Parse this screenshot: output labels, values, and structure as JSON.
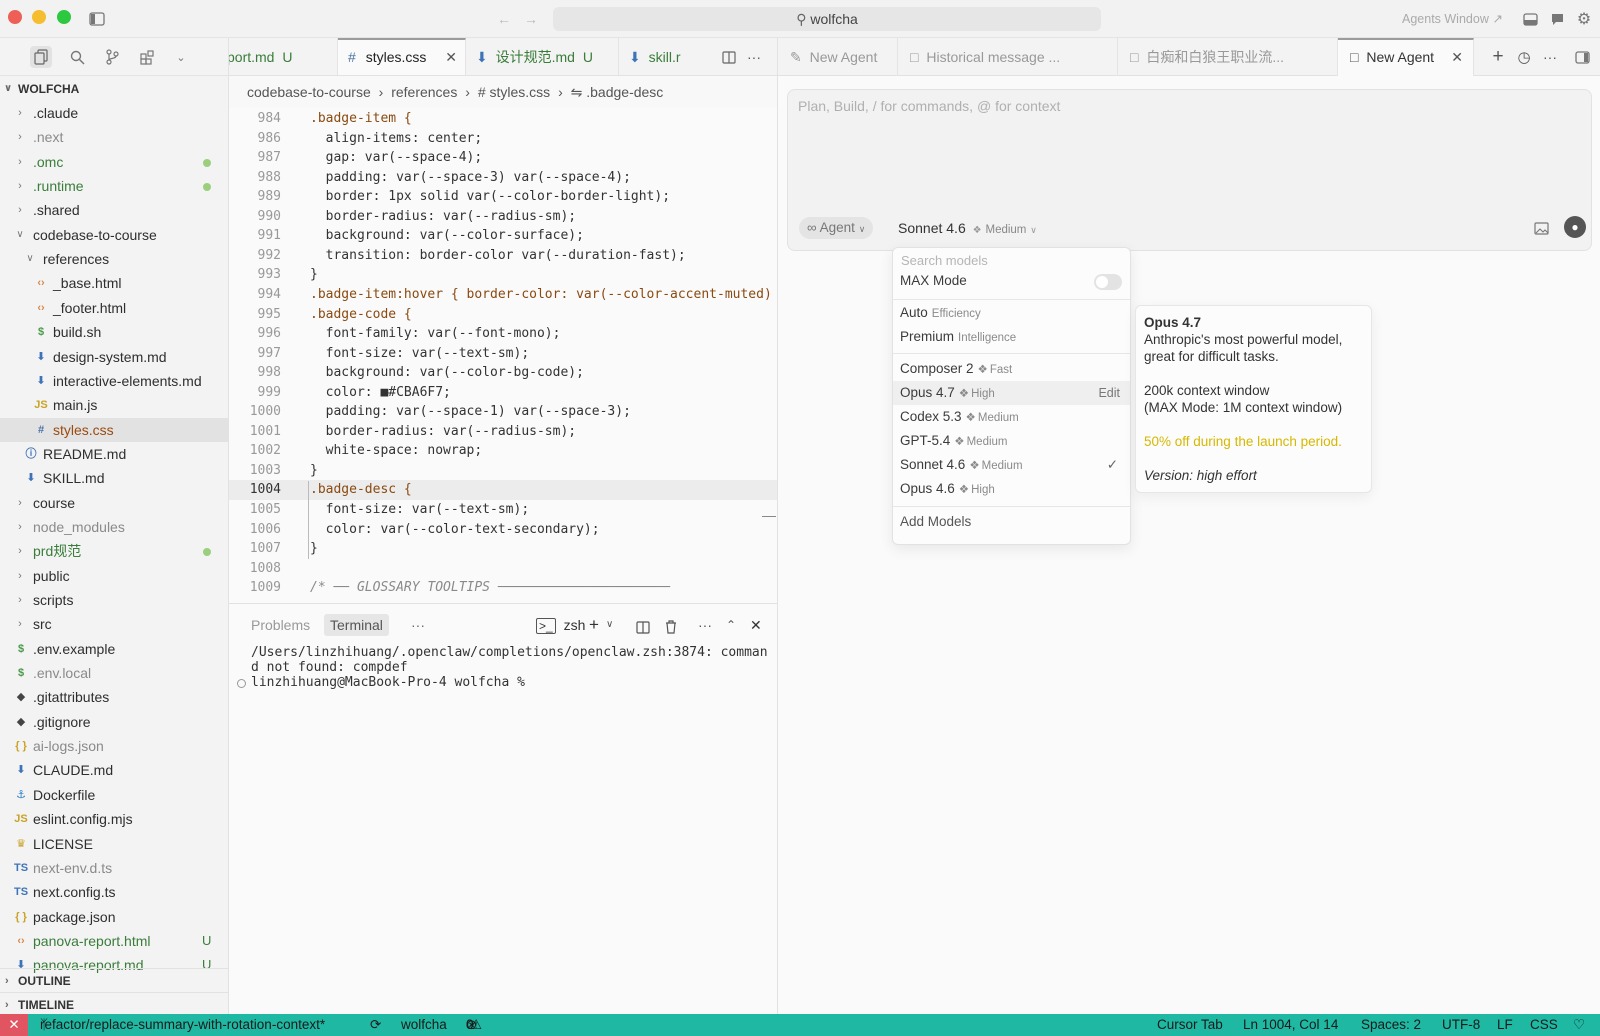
{
  "titlebar": {
    "search_text": "wolfcha",
    "agents_window_label": "Agents Window ↗"
  },
  "explorer": {
    "root_label": "WOLFCHA",
    "items": [
      {
        "label": ".claude",
        "type": "folder",
        "open": false,
        "depth": 0
      },
      {
        "label": ".next",
        "type": "folder",
        "open": false,
        "depth": 0,
        "dim": true
      },
      {
        "label": ".omc",
        "type": "folder",
        "open": false,
        "depth": 0,
        "dot": true,
        "green": true
      },
      {
        "label": ".runtime",
        "type": "folder",
        "open": false,
        "depth": 0,
        "dot": true,
        "green": true
      },
      {
        "label": ".shared",
        "type": "folder",
        "open": false,
        "depth": 0
      },
      {
        "label": "codebase-to-course",
        "type": "folder",
        "open": true,
        "depth": 0
      },
      {
        "label": "references",
        "type": "folder",
        "open": true,
        "depth": 1
      },
      {
        "label": "_base.html",
        "type": "html",
        "depth": 2
      },
      {
        "label": "_footer.html",
        "type": "html",
        "depth": 2
      },
      {
        "label": "build.sh",
        "type": "sh",
        "depth": 2
      },
      {
        "label": "design-system.md",
        "type": "md",
        "depth": 2
      },
      {
        "label": "interactive-elements.md",
        "type": "md",
        "depth": 2
      },
      {
        "label": "main.js",
        "type": "js",
        "depth": 2
      },
      {
        "label": "styles.css",
        "type": "css",
        "depth": 2,
        "selected": true
      },
      {
        "label": "README.md",
        "type": "info",
        "depth": 1
      },
      {
        "label": "SKILL.md",
        "type": "md",
        "depth": 1
      },
      {
        "label": "course",
        "type": "folder",
        "open": false,
        "depth": 0
      },
      {
        "label": "node_modules",
        "type": "folder",
        "open": false,
        "depth": 0,
        "dim": true
      },
      {
        "label": "prd规范",
        "type": "folder",
        "open": false,
        "depth": 0,
        "dot": true,
        "green": true
      },
      {
        "label": "public",
        "type": "folder",
        "open": false,
        "depth": 0
      },
      {
        "label": "scripts",
        "type": "folder",
        "open": false,
        "depth": 0
      },
      {
        "label": "src",
        "type": "folder",
        "open": false,
        "depth": 0
      },
      {
        "label": ".env.example",
        "type": "sh",
        "depth": 0
      },
      {
        "label": ".env.local",
        "type": "sh",
        "depth": 0,
        "dim": true
      },
      {
        "label": ".gitattributes",
        "type": "git",
        "depth": 0
      },
      {
        "label": ".gitignore",
        "type": "git",
        "depth": 0
      },
      {
        "label": "ai-logs.json",
        "type": "json",
        "depth": 0,
        "dim": true
      },
      {
        "label": "CLAUDE.md",
        "type": "md",
        "depth": 0
      },
      {
        "label": "Dockerfile",
        "type": "docker",
        "depth": 0
      },
      {
        "label": "eslint.config.mjs",
        "type": "js",
        "depth": 0
      },
      {
        "label": "LICENSE",
        "type": "license",
        "depth": 0
      },
      {
        "label": "next-env.d.ts",
        "type": "ts",
        "depth": 0,
        "dim": true
      },
      {
        "label": "next.config.ts",
        "type": "ts",
        "depth": 0
      },
      {
        "label": "package.json",
        "type": "json",
        "depth": 0
      },
      {
        "label": "panova-report.html",
        "type": "html",
        "depth": 0,
        "badge": "U",
        "green": true
      },
      {
        "label": "panova-report.md",
        "type": "md",
        "depth": 0,
        "badge": "U",
        "green": true
      }
    ],
    "outline_label": "OUTLINE",
    "timeline_label": "TIMELINE"
  },
  "editor": {
    "tabs": [
      {
        "label": "port.md",
        "badge": "U",
        "icon": ""
      },
      {
        "label": "styles.css",
        "badge": "",
        "icon": "#",
        "active": true
      },
      {
        "label": "设计规范.md",
        "badge": "U",
        "icon": "⬇"
      },
      {
        "label": "skill.r",
        "badge": "",
        "icon": "⬇"
      }
    ],
    "breadcrumb": [
      "codebase-to-course",
      "references",
      "# styles.css",
      ".badge-desc"
    ],
    "current_line": "1004",
    "lines": [
      {
        "n": "984",
        "t": ".badge-item {"
      },
      {
        "n": "986",
        "t": "  align-items: center;"
      },
      {
        "n": "987",
        "t": "  gap: var(--space-4);"
      },
      {
        "n": "988",
        "t": "  padding: var(--space-3) var(--space-4);"
      },
      {
        "n": "989",
        "t": "  border: 1px solid var(--color-border-light);"
      },
      {
        "n": "990",
        "t": "  border-radius: var(--radius-sm);"
      },
      {
        "n": "991",
        "t": "  background: var(--color-surface);"
      },
      {
        "n": "992",
        "t": "  transition: border-color var(--duration-fast);"
      },
      {
        "n": "993",
        "t": "}"
      },
      {
        "n": "994",
        "t": ".badge-item:hover { border-color: var(--color-accent-muted)"
      },
      {
        "n": "995",
        "t": ".badge-code {"
      },
      {
        "n": "996",
        "t": "  font-family: var(--font-mono);"
      },
      {
        "n": "997",
        "t": "  font-size: var(--text-sm);"
      },
      {
        "n": "998",
        "t": "  background: var(--color-bg-code);"
      },
      {
        "n": "999",
        "t": "  color: ■#CBA6F7;"
      },
      {
        "n": "1000",
        "t": "  padding: var(--space-1) var(--space-3);"
      },
      {
        "n": "1001",
        "t": "  border-radius: var(--radius-sm);"
      },
      {
        "n": "1002",
        "t": "  white-space: nowrap;"
      },
      {
        "n": "1003",
        "t": "}"
      },
      {
        "n": "1004",
        "t": ".badge-desc {"
      },
      {
        "n": "1005",
        "t": "  font-size: var(--text-sm);"
      },
      {
        "n": "1006",
        "t": "  color: var(--color-text-secondary);"
      },
      {
        "n": "1007",
        "t": "}"
      },
      {
        "n": "1008",
        "t": ""
      },
      {
        "n": "1009",
        "t": "/* ── GLOSSARY TOOLTIPS ──────────────────────"
      }
    ]
  },
  "panel": {
    "tabs": [
      "Problems",
      "Terminal"
    ],
    "active_tab": "Terminal",
    "shell_label": "zsh",
    "terminal_lines": [
      "/Users/linzhihuang/.openclaw/completions/openclaw.zsh:3874: comman",
      "d not found: compdef",
      "linzhihuang@MacBook-Pro-4 wolfcha %"
    ]
  },
  "agent": {
    "tabs": [
      {
        "label": "New Agent"
      },
      {
        "label": "Historical message ..."
      },
      {
        "label": "白痴和白狼王职业流..."
      },
      {
        "label": "New Agent",
        "active": true
      }
    ],
    "composer_placeholder": "Plan, Build, / for commands, @ for context",
    "mode_label": "Agent",
    "model_label": "Sonnet 4.6",
    "effort_label": "Medium"
  },
  "model_menu": {
    "search_placeholder": "Search models",
    "max_mode_label": "MAX Mode",
    "max_mode_on": false,
    "groups": [
      [
        {
          "name": "Auto",
          "sub": "Efficiency"
        },
        {
          "name": "Premium",
          "sub": "Intelligence"
        }
      ],
      [
        {
          "name": "Composer 2",
          "sub": "Fast"
        },
        {
          "name": "Opus 4.7",
          "sub": "High",
          "action": "Edit",
          "highlighted": true
        },
        {
          "name": "Codex 5.3",
          "sub": "Medium"
        },
        {
          "name": "GPT-5.4",
          "sub": "Medium"
        },
        {
          "name": "Sonnet 4.6",
          "sub": "Medium",
          "checked": true
        },
        {
          "name": "Opus 4.6",
          "sub": "High"
        }
      ]
    ],
    "add_models_label": "Add Models"
  },
  "tooltip": {
    "title": "Opus 4.7",
    "description": "Anthropic's most powerful model, great for difficult tasks.",
    "context": "200k context window",
    "context_max": "(MAX Mode: 1M context window)",
    "promo": "50% off during the launch period.",
    "version": "Version: high effort",
    "promo_color": "#d6b800"
  },
  "statusbar": {
    "branch": "refactor/replace-summary-with-rotation-context*",
    "workspace": "wolfcha",
    "errors": "0",
    "warnings": "0",
    "cursor_tab": "Cursor Tab",
    "position": "Ln 1004, Col 14",
    "spaces": "Spaces: 2",
    "encoding": "UTF-8",
    "eol": "LF",
    "language": "CSS",
    "bg_color": "#1fb8a3"
  }
}
